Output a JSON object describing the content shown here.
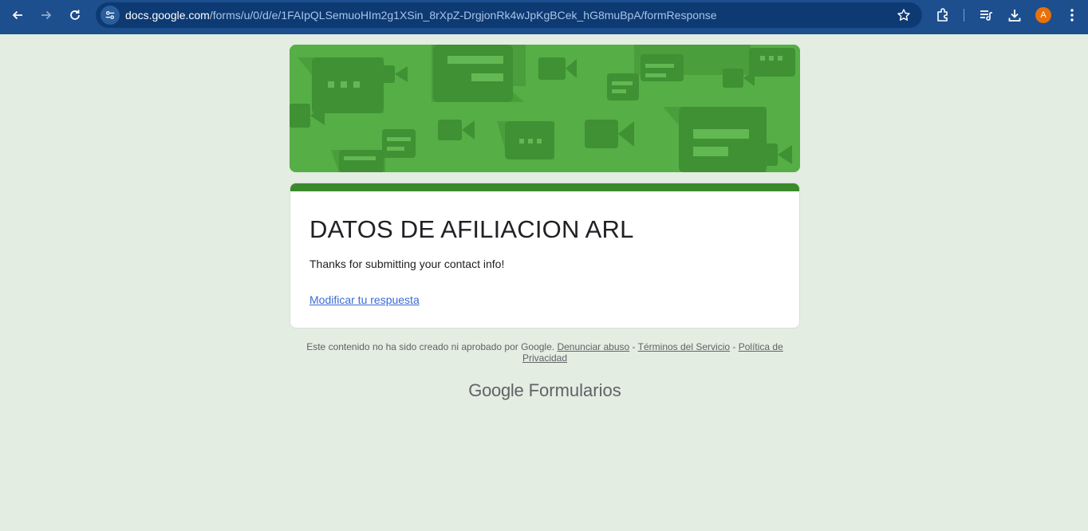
{
  "browser": {
    "url_host": "docs.google.com",
    "url_path": "/forms/u/0/d/e/1FAIpQLSemuoHIm2g1XSin_8rXpZ-DrgjonRk4wJpKgBCek_hG8muBpA/formResponse",
    "profile_initial": "A",
    "colors": {
      "toolbar": "#1d4f8f",
      "omnibox": "#0d3a73",
      "avatar": "#e8710a"
    }
  },
  "form": {
    "title": "DATOS DE AFILIACION ARL",
    "confirmation": "Thanks for submitting your contact info!",
    "edit_link": "Modificar tu respuesta",
    "theme_color": "#3a8a2c"
  },
  "footer": {
    "disclaimer": "Este contenido no ha sido creado ni aprobado por Google.",
    "report_abuse": "Denunciar abuso",
    "sep1": "-",
    "terms": "Términos del Servicio",
    "sep2": "-",
    "privacy": "Política de Privacidad"
  },
  "brand": {
    "google": "Google",
    "product": "Formularios"
  },
  "page_background": "#e3ede1"
}
